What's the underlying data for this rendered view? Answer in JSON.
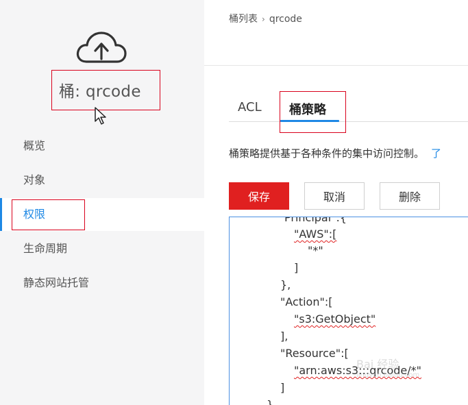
{
  "sidebar": {
    "bucket_label": "桶: qrcode",
    "items": [
      {
        "label": "概览",
        "active": false
      },
      {
        "label": "对象",
        "active": false
      },
      {
        "label": "权限",
        "active": true
      },
      {
        "label": "生命周期",
        "active": false
      },
      {
        "label": "静态网站托管",
        "active": false
      }
    ]
  },
  "breadcrumb": {
    "parent": "桶列表",
    "separator": "›",
    "current": "qrcode"
  },
  "tabs": [
    {
      "label": "ACL",
      "active": false
    },
    {
      "label": "桶策略",
      "active": true
    }
  ],
  "description": {
    "text": "桶策略提供基于各种条件的集中访问控制。",
    "link": "了"
  },
  "buttons": {
    "save": "保存",
    "cancel": "取消",
    "delete": "删除"
  },
  "editor": {
    "lines": [
      "Principal\":{",
      "\"AWS\":[",
      "\"*\"",
      "]",
      "},",
      "\"Action\":[",
      "\"s3:GetObject\"",
      "],",
      "\"Resource\":[",
      "\"arn:aws:s3:::qrcode/*\"",
      "]",
      "}"
    ]
  },
  "watermark": {
    "text": "Bai 经验",
    "url": "jingyan.baidu.com"
  },
  "colors": {
    "accent": "#1e88e5",
    "primary_button": "#e02020",
    "highlight_box": "#d9001b",
    "sidebar_bg": "#f5f5f6"
  }
}
